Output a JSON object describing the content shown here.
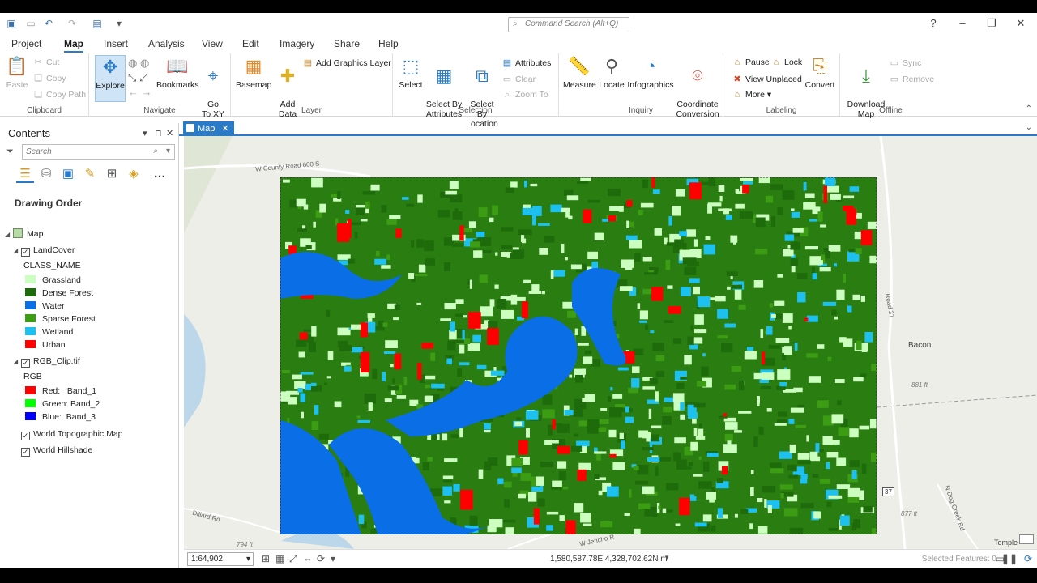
{
  "title_bar": {
    "command_search_placeholder": "Command Search (Alt+Q)",
    "help": "?"
  },
  "menu_tabs": [
    "Project",
    "Map",
    "Insert",
    "Analysis",
    "View",
    "Edit",
    "Imagery",
    "Share",
    "Help"
  ],
  "active_tab": "Map",
  "ribbon": {
    "clipboard": {
      "paste": "Paste",
      "cut": "Cut",
      "copy": "Copy",
      "copy_path": "Copy Path",
      "label": "Clipboard"
    },
    "navigate": {
      "explore": "Explore",
      "bookmarks": "Bookmarks",
      "go_to_xy": "Go\nTo XY",
      "label": "Navigate"
    },
    "layer": {
      "basemap": "Basemap",
      "add_data": "Add\nData",
      "add_graphics_layer": "Add Graphics Layer",
      "label": "Layer"
    },
    "selection": {
      "select": "Select",
      "select_by_attributes": "Select By\nAttributes",
      "select_by_location": "Select By\nLocation",
      "attributes": "Attributes",
      "clear": "Clear",
      "zoom_to": "Zoom To",
      "label": "Selection"
    },
    "inquiry": {
      "measure": "Measure",
      "locate": "Locate",
      "infographics": "Infographics",
      "coordinate_conversion": "Coordinate\nConversion",
      "label": "Inquiry"
    },
    "labeling": {
      "pause": "Pause",
      "lock": "Lock",
      "view_unplaced": "View Unplaced",
      "more": "More",
      "convert": "Convert",
      "label": "Labeling"
    },
    "offline": {
      "download_map": "Download\nMap",
      "sync": "Sync",
      "remove": "Remove",
      "label": "Offline"
    }
  },
  "contents": {
    "title": "Contents",
    "search_placeholder": "Search",
    "drawing_order": "Drawing Order",
    "map_name": "Map",
    "landcover": {
      "name": "LandCover",
      "field": "CLASS_NAME",
      "classes": [
        {
          "label": "Grassland",
          "color": "#ccffbf"
        },
        {
          "label": "Dense Forest",
          "color": "#1d6b0a"
        },
        {
          "label": "Water",
          "color": "#0a6ee6"
        },
        {
          "label": "Sparse Forest",
          "color": "#3c9c14"
        },
        {
          "label": "Wetland",
          "color": "#1ec0f0"
        },
        {
          "label": "Urban",
          "color": "#ff0000"
        }
      ]
    },
    "rgb_layer": {
      "name": "RGB_Clip.tif",
      "label": "RGB",
      "bands": [
        {
          "label": "Red:   Band_1",
          "color": "#ff0000"
        },
        {
          "label": "Green: Band_2",
          "color": "#00ff00"
        },
        {
          "label": "Blue:  Band_3",
          "color": "#0000ff"
        }
      ]
    },
    "basemaps": [
      "World Topographic Map",
      "World Hillshade"
    ]
  },
  "map_tab": "Map",
  "map_labels": {
    "road1": "W County Road 600 S",
    "road2": "Road 37",
    "town": "Bacon",
    "elev1": "881 ft",
    "elev2": "877 ft",
    "elev3": "794 ft",
    "road3": "Dillard Rd",
    "road4": "W Jericho R",
    "road5": "N Dog Creek Rd",
    "shield": "37",
    "place": "Temple"
  },
  "status": {
    "scale": "1:64,902",
    "coordinates": "1,580,587.78E 4,328,702.62N m",
    "selected_features": "Selected Features: 0"
  }
}
